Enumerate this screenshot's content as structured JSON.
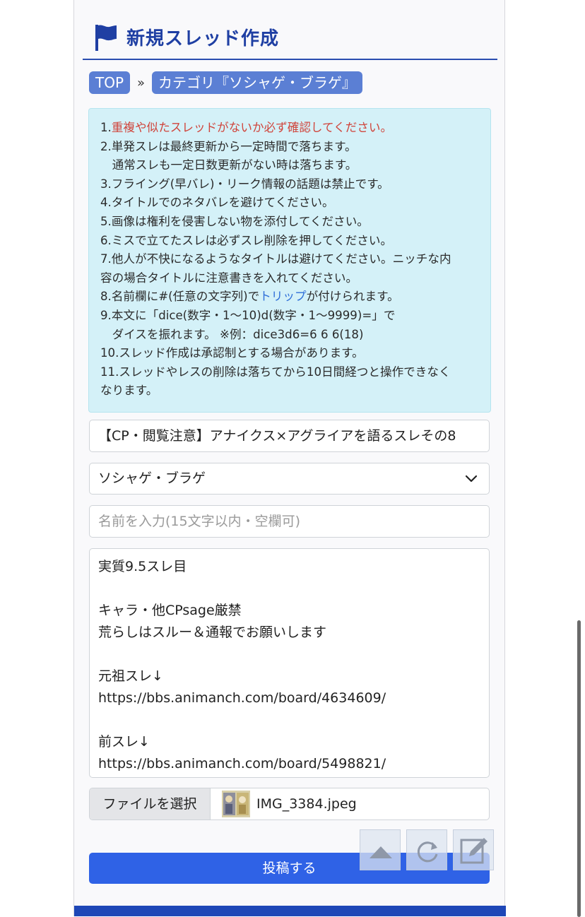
{
  "header": {
    "title": "新規スレッド作成",
    "icon": "flag-icon"
  },
  "breadcrumb": {
    "top": "TOP",
    "separator": "»",
    "category": "カテゴリ『ソシャゲ・ブラゲ』"
  },
  "rules": [
    {
      "prefix": "1.",
      "text": "重複や似たスレッドがないか必ず確認してください。",
      "red": true
    },
    {
      "text": "2.単発スレは最終更新から一定時間で落ちます。"
    },
    {
      "text": "　通常スレも一定日数更新がない時は落ちます。"
    },
    {
      "text": "3.フライング(早バレ)・リーク情報の話題は禁止です。"
    },
    {
      "text": "4.タイトルでのネタバレを避けてください。"
    },
    {
      "text": "5.画像は権利を侵害しない物を添付してください。"
    },
    {
      "text": "6.ミスで立てたスレは必ずスレ削除を押してください。"
    },
    {
      "text": "7.他人が不快になるようなタイトルは避けてください。ニッチな内"
    },
    {
      "text": "容の場合タイトルに注意書きを入れてください。"
    },
    {
      "text": "8.名前欄に#(任意の文字列)で",
      "link": "トリップ",
      "after": "が付けられます。"
    },
    {
      "text": "9.本文に「dice(数字・1〜10)d(数字・1〜9999)=」で"
    },
    {
      "text": "　ダイスを振れます。 ※例：dice3d6=6 6 6(18)"
    },
    {
      "text": "10.スレッド作成は承認制とする場合があります。"
    },
    {
      "text": "11.スレッドやレスの削除は落ちてから10日間経つと操作できなく"
    },
    {
      "text": "なります。"
    }
  ],
  "form": {
    "title_value": "【CP・閲覧注意】アナイクス×アグライアを語るスレその8",
    "category_selected": "ソシャゲ・ブラゲ",
    "name_placeholder": "名前を入力(15文字以内・空欄可)",
    "body_value": "実質9.5スレ目\n\nキャラ・他CPsage厳禁\n荒らしはスルー＆通報でお願いします\n\n元祖スレ↓\nhttps://bbs.animanch.com/board/4634609/\n\n前スレ↓\nhttps://bbs.animanch.com/board/5498821/",
    "file_button": "ファイルを選択",
    "file_name": "IMG_3384.jpeg",
    "submit_label": "投稿する"
  },
  "floating_buttons": [
    "scroll-top-icon",
    "reload-icon",
    "edit-icon"
  ],
  "colors": {
    "accent": "#2a4db0",
    "submit": "#2f62e6",
    "rules_bg": "#d4f1f8",
    "warning": "#d0443b",
    "link": "#2f6fd8"
  }
}
